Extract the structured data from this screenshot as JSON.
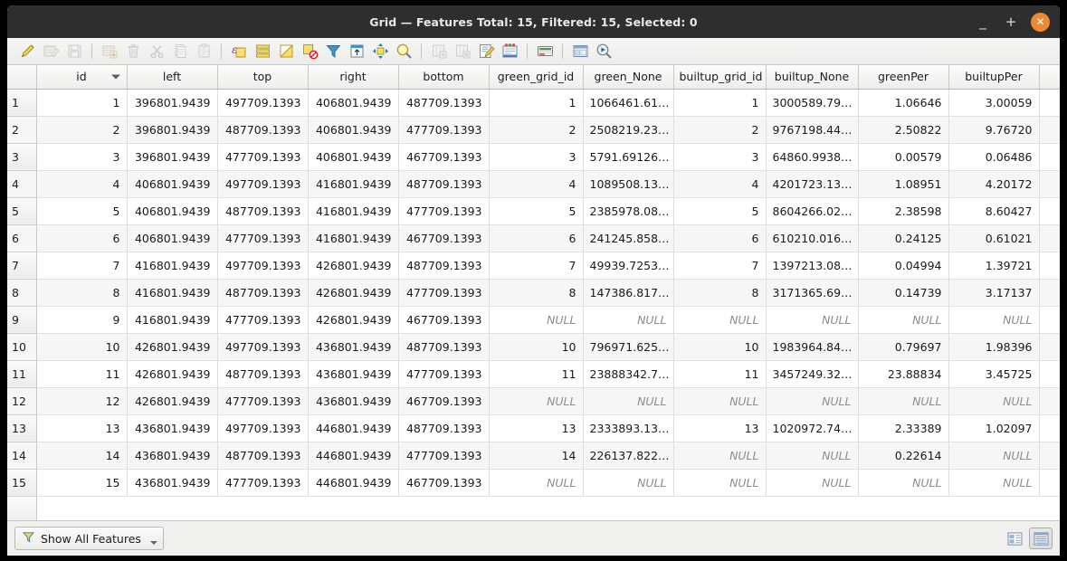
{
  "window": {
    "title": "Grid — Features Total: 15, Filtered: 15, Selected: 0",
    "minimize_label": "_",
    "maximize_label": "+",
    "close_label": "✕",
    "accent_close": "#f0882e",
    "titlebar_bg": "#2e2e2e"
  },
  "toolbar": {
    "items": [
      {
        "name": "toggle-editing-icon",
        "title": "Toggle editing mode",
        "enabled": true
      },
      {
        "name": "save-edits-icon",
        "title": "Save edits",
        "enabled": false
      },
      {
        "name": "reload-table-icon",
        "title": "Reload the table",
        "enabled": false
      },
      {
        "name": "separator",
        "title": "",
        "enabled": true
      },
      {
        "name": "add-feature-icon",
        "title": "Add feature",
        "enabled": false
      },
      {
        "name": "delete-selected-icon",
        "title": "Delete selected features",
        "enabled": false
      },
      {
        "name": "cut-features-icon",
        "title": "Cut selected features",
        "enabled": false
      },
      {
        "name": "copy-features-icon",
        "title": "Copy selected features",
        "enabled": false
      },
      {
        "name": "paste-features-icon",
        "title": "Paste features",
        "enabled": false
      },
      {
        "name": "separator",
        "title": "",
        "enabled": true
      },
      {
        "name": "select-by-expression-icon",
        "title": "Select features using an expression",
        "enabled": true
      },
      {
        "name": "select-all-icon",
        "title": "Select all features",
        "enabled": true
      },
      {
        "name": "invert-selection-icon",
        "title": "Invert selection",
        "enabled": true
      },
      {
        "name": "deselect-all-icon",
        "title": "Deselect all features",
        "enabled": true
      },
      {
        "name": "filter-selection-icon",
        "title": "Filter / select features",
        "enabled": true
      },
      {
        "name": "move-selection-to-top-icon",
        "title": "Move selection to top",
        "enabled": true
      },
      {
        "name": "pan-to-selection-icon",
        "title": "Pan map to selected rows",
        "enabled": true
      },
      {
        "name": "zoom-to-selection-icon",
        "title": "Zoom map to selected rows",
        "enabled": true
      },
      {
        "name": "separator",
        "title": "",
        "enabled": true
      },
      {
        "name": "new-field-icon",
        "title": "New field",
        "enabled": false
      },
      {
        "name": "delete-field-icon",
        "title": "Delete field",
        "enabled": false
      },
      {
        "name": "open-field-calculator-icon",
        "title": "Open field calculator",
        "enabled": true
      },
      {
        "name": "conditional-formatting-icon",
        "title": "Conditional formatting",
        "enabled": true
      },
      {
        "name": "separator",
        "title": "",
        "enabled": true
      },
      {
        "name": "organize-columns-icon",
        "title": "Organize columns",
        "enabled": true
      },
      {
        "name": "separator",
        "title": "",
        "enabled": true
      },
      {
        "name": "dock-undock-icon",
        "title": "Dock attribute table",
        "enabled": true
      },
      {
        "name": "actions-icon",
        "title": "Actions",
        "enabled": true
      }
    ]
  },
  "table": {
    "row_header_label": "",
    "sorted_column": "id",
    "sort_direction": "descending",
    "columns": [
      "id",
      "left",
      "top",
      "right",
      "bottom",
      "green_grid_id",
      "green_None",
      "builtup_grid_id",
      "builtup_None",
      "greenPer",
      "builtupPer"
    ],
    "rows": [
      {
        "n": "1",
        "cells": [
          "1",
          "396801.9439",
          "497709.1393",
          "406801.9439",
          "487709.1393",
          "1",
          "1066461.61…",
          "1",
          "3000589.79…",
          "1.06646",
          "3.00059"
        ]
      },
      {
        "n": "2",
        "cells": [
          "2",
          "396801.9439",
          "487709.1393",
          "406801.9439",
          "477709.1393",
          "2",
          "2508219.23…",
          "2",
          "9767198.44…",
          "2.50822",
          "9.76720"
        ]
      },
      {
        "n": "3",
        "cells": [
          "3",
          "396801.9439",
          "477709.1393",
          "406801.9439",
          "467709.1393",
          "3",
          "5791.69126…",
          "3",
          "64860.9938…",
          "0.00579",
          "0.06486"
        ]
      },
      {
        "n": "4",
        "cells": [
          "4",
          "406801.9439",
          "497709.1393",
          "416801.9439",
          "487709.1393",
          "4",
          "1089508.13…",
          "4",
          "4201723.13…",
          "1.08951",
          "4.20172"
        ]
      },
      {
        "n": "5",
        "cells": [
          "5",
          "406801.9439",
          "487709.1393",
          "416801.9439",
          "477709.1393",
          "5",
          "2385978.08…",
          "5",
          "8604266.02…",
          "2.38598",
          "8.60427"
        ]
      },
      {
        "n": "6",
        "cells": [
          "6",
          "406801.9439",
          "477709.1393",
          "416801.9439",
          "467709.1393",
          "6",
          "241245.858…",
          "6",
          "610210.016…",
          "0.24125",
          "0.61021"
        ]
      },
      {
        "n": "7",
        "cells": [
          "7",
          "416801.9439",
          "497709.1393",
          "426801.9439",
          "487709.1393",
          "7",
          "49939.7253…",
          "7",
          "1397213.08…",
          "0.04994",
          "1.39721"
        ]
      },
      {
        "n": "8",
        "cells": [
          "8",
          "416801.9439",
          "487709.1393",
          "426801.9439",
          "477709.1393",
          "8",
          "147386.817…",
          "8",
          "3171365.69…",
          "0.14739",
          "3.17137"
        ]
      },
      {
        "n": "9",
        "cells": [
          "9",
          "416801.9439",
          "477709.1393",
          "426801.9439",
          "467709.1393",
          "NULL",
          "NULL",
          "NULL",
          "NULL",
          "NULL",
          "NULL"
        ]
      },
      {
        "n": "10",
        "cells": [
          "10",
          "426801.9439",
          "497709.1393",
          "436801.9439",
          "487709.1393",
          "10",
          "796971.625…",
          "10",
          "1983964.84…",
          "0.79697",
          "1.98396"
        ]
      },
      {
        "n": "11",
        "cells": [
          "11",
          "426801.9439",
          "487709.1393",
          "436801.9439",
          "477709.1393",
          "11",
          "23888342.7…",
          "11",
          "3457249.32…",
          "23.88834",
          "3.45725"
        ]
      },
      {
        "n": "12",
        "cells": [
          "12",
          "426801.9439",
          "477709.1393",
          "436801.9439",
          "467709.1393",
          "NULL",
          "NULL",
          "NULL",
          "NULL",
          "NULL",
          "NULL"
        ]
      },
      {
        "n": "13",
        "cells": [
          "13",
          "436801.9439",
          "497709.1393",
          "446801.9439",
          "487709.1393",
          "13",
          "2333893.13…",
          "13",
          "1020972.74…",
          "2.33389",
          "1.02097"
        ]
      },
      {
        "n": "14",
        "cells": [
          "14",
          "436801.9439",
          "487709.1393",
          "446801.9439",
          "477709.1393",
          "14",
          "226137.822…",
          "NULL",
          "NULL",
          "0.22614",
          "NULL"
        ]
      },
      {
        "n": "15",
        "cells": [
          "15",
          "436801.9439",
          "477709.1393",
          "446801.9439",
          "467709.1393",
          "NULL",
          "NULL",
          "NULL",
          "NULL",
          "NULL",
          "NULL"
        ]
      }
    ],
    "null_text": "NULL"
  },
  "statusbar": {
    "show_all_label": "Show All Features",
    "filter_icon": "funnel-icon",
    "views": [
      {
        "name": "form-view-button",
        "active": false
      },
      {
        "name": "table-view-button",
        "active": true
      }
    ]
  }
}
